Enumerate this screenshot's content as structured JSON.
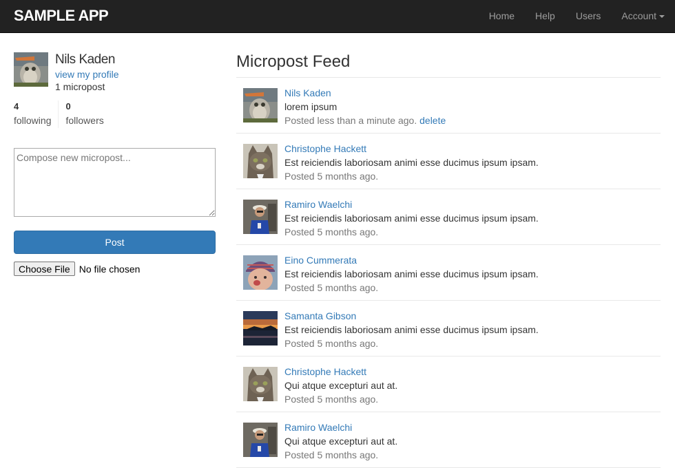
{
  "header": {
    "brand": "SAMPLE APP",
    "nav": [
      "Home",
      "Help",
      "Users",
      "Account"
    ]
  },
  "sidebar": {
    "user_name": "Nils Kaden",
    "profile_link": "view my profile",
    "micropost_count": "1 micropost",
    "stats": {
      "following_count": "4",
      "following_label": "following",
      "followers_count": "0",
      "followers_label": "followers"
    },
    "compose_placeholder": "Compose new micropost...",
    "post_button": "Post",
    "file_button": "Choose File",
    "file_status": "No file chosen"
  },
  "feed": {
    "title": "Micropost Feed",
    "posts": [
      {
        "user": "Nils Kaden",
        "content": "lorem ipsum",
        "time": "Posted less than a minute ago.",
        "action": "delete",
        "avatar": "owl"
      },
      {
        "user": "Christophe Hackett",
        "content": "Est reiciendis laboriosam animi esse ducimus ipsum ipsam.",
        "time": "Posted 5 months ago.",
        "avatar": "cat"
      },
      {
        "user": "Ramiro Waelchi",
        "content": "Est reiciendis laboriosam animi esse ducimus ipsum ipsam.",
        "time": "Posted 5 months ago.",
        "avatar": "person"
      },
      {
        "user": "Eino Cummerata",
        "content": "Est reiciendis laboriosam animi esse ducimus ipsum ipsam.",
        "time": "Posted 5 months ago.",
        "avatar": "baby"
      },
      {
        "user": "Samanta Gibson",
        "content": "Est reiciendis laboriosam animi esse ducimus ipsum ipsam.",
        "time": "Posted 5 months ago.",
        "avatar": "sunset"
      },
      {
        "user": "Christophe Hackett",
        "content": "Qui atque excepturi aut at.",
        "time": "Posted 5 months ago.",
        "avatar": "cat"
      },
      {
        "user": "Ramiro Waelchi",
        "content": "Qui atque excepturi aut at.",
        "time": "Posted 5 months ago.",
        "avatar": "person"
      }
    ]
  },
  "colors": {
    "navbar": "#222222",
    "link": "#337ab7",
    "primary_button": "#337ab7",
    "muted_text": "#777777"
  }
}
